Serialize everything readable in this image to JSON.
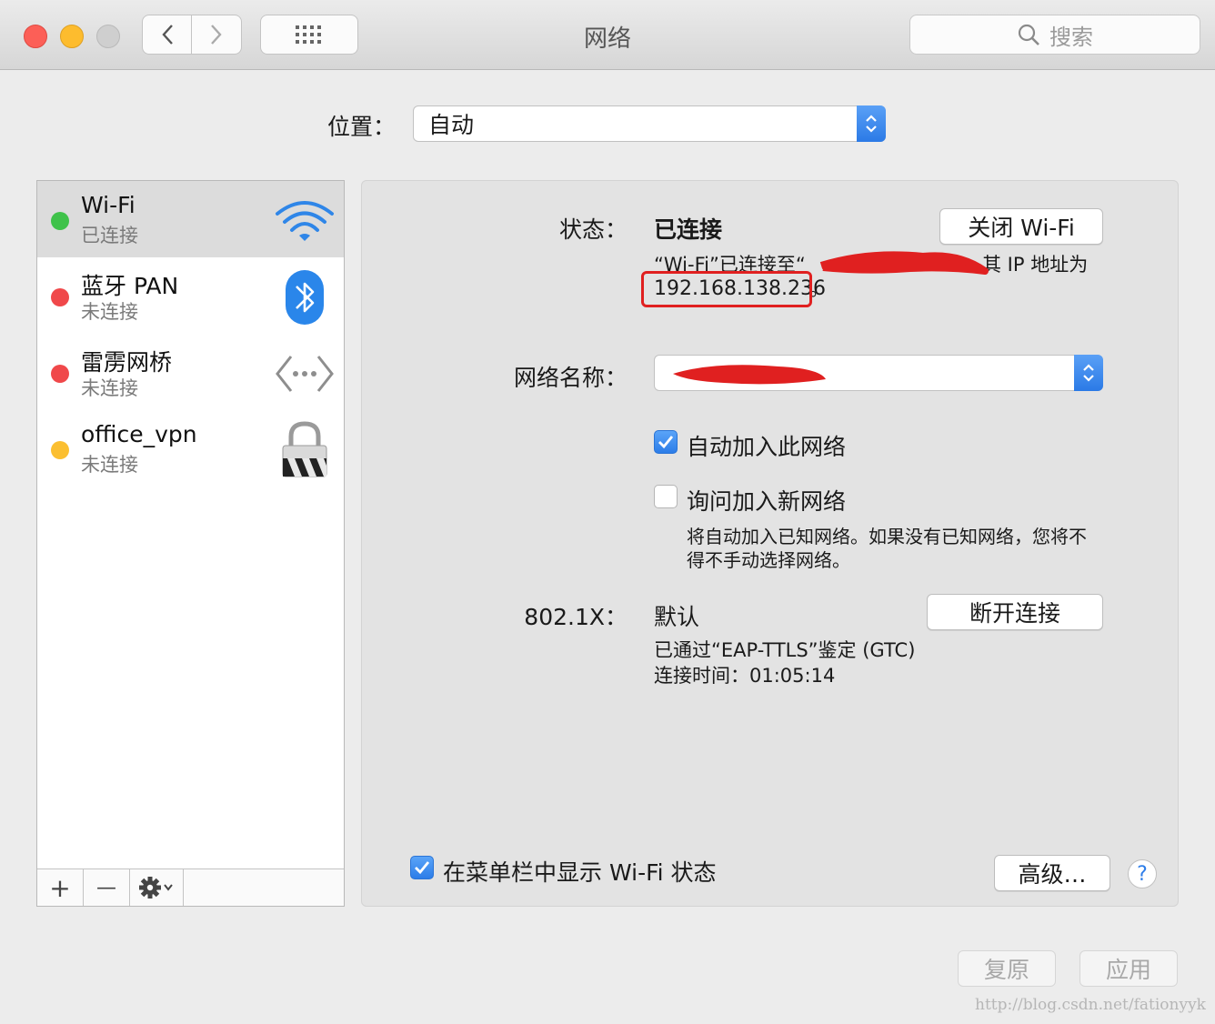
{
  "window": {
    "title": "网络",
    "search_placeholder": "搜索"
  },
  "location": {
    "label": "位置：",
    "value": "自动"
  },
  "services": [
    {
      "name": "Wi-Fi",
      "status": "已连接",
      "color": "#3fc24a",
      "icon": "wifi-icon"
    },
    {
      "name": "蓝牙 PAN",
      "status": "未连接",
      "color": "#f0484a",
      "icon": "bluetooth-icon"
    },
    {
      "name": "雷雳网桥",
      "status": "未连接",
      "color": "#f0484a",
      "icon": "thunderbolt-bridge-icon"
    },
    {
      "name": "office_vpn",
      "status": "未连接",
      "color": "#fbbf31",
      "icon": "vpn-lock-icon"
    }
  ],
  "sidebar_controls": {
    "add": "+",
    "remove": "—"
  },
  "detail": {
    "status_label": "状态：",
    "status_value": "已连接",
    "turn_off_button": "关闭 Wi-Fi",
    "status_desc_line1_a": "“Wi-Fi”已连接至“",
    "status_desc_line1_b": "其 IP 地址为",
    "ip_address": "192.168.138.236",
    "ip_suffix": "。",
    "network_name_label": "网络名称：",
    "network_name_value": "",
    "auto_join_label": "自动加入此网络",
    "auto_join_checked": true,
    "ask_join_label": "询问加入新网络",
    "ask_join_checked": false,
    "ask_join_desc_1": "将自动加入已知网络。如果没有已知网络，您将不",
    "ask_join_desc_2": "得不手动选择网络。",
    "dot1x_label": "802.1X：",
    "dot1x_value": "默认",
    "disconnect_button": "断开连接",
    "dot1x_auth": "已通过“EAP-TTLS”鉴定 (GTC)",
    "dot1x_time": "连接时间：01:05:14",
    "show_menu_label": "在菜单栏中显示 Wi-Fi 状态",
    "show_menu_checked": true,
    "advanced_button": "高级…",
    "help": "?"
  },
  "footer": {
    "revert": "复原",
    "apply": "应用"
  },
  "watermark": "http://blog.csdn.net/fationyyk",
  "colors": {
    "accent": "#2c7de8",
    "annotation_red": "#e02020"
  }
}
